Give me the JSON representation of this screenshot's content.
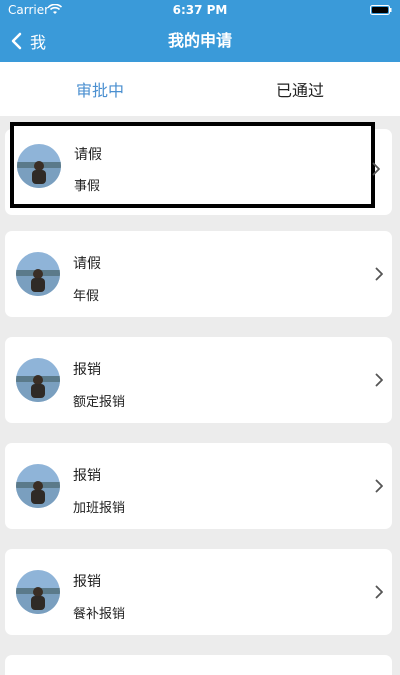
{
  "status_bar": {
    "carrier": "Carrier",
    "time": "6:37 PM"
  },
  "nav": {
    "back_label": "我",
    "title": "我的申请"
  },
  "tabs": [
    {
      "label": "审批中",
      "active": true
    },
    {
      "label": "已通过",
      "active": false
    }
  ],
  "items": [
    {
      "title": "请假",
      "subtitle": "事假"
    },
    {
      "title": "请假",
      "subtitle": "年假"
    },
    {
      "title": "报销",
      "subtitle": "额定报销"
    },
    {
      "title": "报销",
      "subtitle": "加班报销"
    },
    {
      "title": "报销",
      "subtitle": "餐补报销"
    }
  ],
  "colors": {
    "accent": "#3a9ad9",
    "active_tab": "#4a8fd0"
  }
}
